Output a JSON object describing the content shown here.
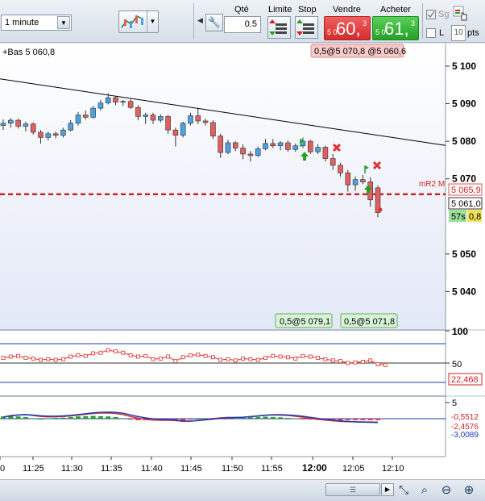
{
  "toolbar": {
    "timeframe": "1 minute",
    "qty_label": "Qté",
    "qty_value": "0.5",
    "limit_label": "Limite",
    "stop_label": "Stop",
    "sell_label": "Vendre",
    "buy_label": "Acheter",
    "sell_prefix": "5 0",
    "sell_big": "60,",
    "sell_sup": "3",
    "buy_prefix": "5 0",
    "buy_big": "61,",
    "buy_sup": "3",
    "sg_label": "Sg",
    "l_label": "L",
    "pts_value": "10",
    "pts_label": "pts"
  },
  "chart": {
    "low_label": "+Bas 5 060,8",
    "order_top": "0,5@5 070,8 @5 060,6",
    "order_bottom_1": "0,5@5 079,1",
    "order_bottom_2": "0,5@5 071,8",
    "mr2_label": "mR2 M",
    "mr2_value": "5 065,9",
    "current_price": "5 061,0",
    "countdown": "57s",
    "spread": "0,8",
    "rsi_value": "22,468",
    "macd_val_1": "-0,5512",
    "macd_val_2": "-2,4576",
    "macd_val_3": "-3,0089",
    "price_ticks": [
      "5 100",
      "5 090",
      "5 080",
      "5 070",
      "5 050",
      "5 040"
    ],
    "rsi_ticks": [
      "100",
      "50"
    ],
    "macd_ticks": [
      "5"
    ],
    "time_ticks": [
      "0",
      "11:25",
      "11:30",
      "11:35",
      "11:40",
      "11:45",
      "11:50",
      "11:55",
      "12:00",
      "12:05",
      "12:10"
    ]
  },
  "chart_data": {
    "type": "candlestick",
    "ylim": [
      5030,
      5106
    ],
    "candles": [
      [
        5084.2,
        5085.8,
        5083.0,
        5084.8
      ],
      [
        5084.8,
        5086.2,
        5083.6,
        5085.6
      ],
      [
        5085.6,
        5086.0,
        5083.4,
        5084.0
      ],
      [
        5084.0,
        5085.2,
        5082.6,
        5084.6
      ],
      [
        5084.6,
        5085.0,
        5081.8,
        5082.4
      ],
      [
        5082.4,
        5083.0,
        5079.4,
        5081.0
      ],
      [
        5081.0,
        5082.6,
        5080.2,
        5082.0
      ],
      [
        5082.0,
        5082.6,
        5080.8,
        5081.6
      ],
      [
        5081.6,
        5083.6,
        5081.0,
        5083.0
      ],
      [
        5083.0,
        5085.6,
        5082.6,
        5084.8
      ],
      [
        5084.8,
        5087.8,
        5084.2,
        5087.0
      ],
      [
        5087.0,
        5088.2,
        5085.8,
        5086.4
      ],
      [
        5086.4,
        5089.4,
        5086.0,
        5088.8
      ],
      [
        5088.8,
        5091.0,
        5088.2,
        5090.2
      ],
      [
        5090.2,
        5092.8,
        5089.8,
        5091.6
      ],
      [
        5091.6,
        5092.0,
        5089.6,
        5090.4
      ],
      [
        5090.4,
        5091.0,
        5089.4,
        5090.6
      ],
      [
        5090.6,
        5091.2,
        5088.6,
        5089.0
      ],
      [
        5089.0,
        5089.6,
        5085.6,
        5086.6
      ],
      [
        5086.6,
        5087.6,
        5084.6,
        5087.0
      ],
      [
        5087.0,
        5087.6,
        5084.6,
        5085.6
      ],
      [
        5085.6,
        5087.2,
        5085.0,
        5086.6
      ],
      [
        5086.6,
        5087.0,
        5082.0,
        5083.0
      ],
      [
        5083.0,
        5083.6,
        5078.6,
        5081.6
      ],
      [
        5081.6,
        5085.2,
        5081.0,
        5084.8
      ],
      [
        5084.8,
        5087.6,
        5084.2,
        5086.8
      ],
      [
        5086.8,
        5088.6,
        5084.6,
        5085.4
      ],
      [
        5085.4,
        5086.0,
        5084.2,
        5085.0
      ],
      [
        5085.0,
        5085.6,
        5080.6,
        5081.4
      ],
      [
        5081.4,
        5082.0,
        5075.6,
        5077.0
      ],
      [
        5077.0,
        5080.4,
        5076.6,
        5079.6
      ],
      [
        5079.6,
        5080.0,
        5077.4,
        5078.2
      ],
      [
        5078.2,
        5079.2,
        5075.2,
        5076.6
      ],
      [
        5076.6,
        5077.4,
        5074.6,
        5076.2
      ],
      [
        5076.2,
        5078.6,
        5075.8,
        5078.0
      ],
      [
        5078.0,
        5080.6,
        5077.6,
        5079.4
      ],
      [
        5079.4,
        5080.6,
        5078.2,
        5078.8
      ],
      [
        5078.8,
        5080.0,
        5077.6,
        5079.6
      ],
      [
        5079.6,
        5080.2,
        5077.2,
        5077.8
      ],
      [
        5077.8,
        5079.4,
        5077.2,
        5078.8
      ],
      [
        5078.8,
        5081.0,
        5078.2,
        5080.0
      ],
      [
        5080.0,
        5080.4,
        5076.6,
        5077.2
      ],
      [
        5077.2,
        5079.2,
        5076.6,
        5078.4
      ],
      [
        5078.4,
        5078.8,
        5074.6,
        5075.4
      ],
      [
        5075.4,
        5076.6,
        5072.4,
        5073.6
      ],
      [
        5073.6,
        5074.2,
        5070.6,
        5071.6
      ],
      [
        5071.6,
        5072.4,
        5066.6,
        5068.4
      ],
      [
        5068.4,
        5070.6,
        5066.8,
        5069.8
      ],
      [
        5069.8,
        5071.0,
        5068.6,
        5069.2
      ],
      [
        5069.2,
        5070.4,
        5062.6,
        5064.4
      ],
      [
        5067.6,
        5068.2,
        5059.8,
        5061.0
      ]
    ],
    "rsi_points": [
      58,
      60,
      61,
      58,
      57,
      55,
      56,
      55,
      56,
      60,
      62,
      61,
      65,
      66,
      70,
      68,
      66,
      62,
      60,
      61,
      56,
      57,
      60,
      53,
      59,
      62,
      63,
      61,
      59,
      55,
      56,
      54,
      57,
      56,
      55,
      58,
      61,
      60,
      59,
      57,
      61,
      60,
      58,
      56,
      54,
      53,
      50,
      51,
      52,
      54,
      48,
      47
    ],
    "macd_hist": [
      0.8,
      0.9,
      0.8,
      0.6,
      0.2,
      0.0,
      0.1,
      0.3,
      0.4,
      0.6,
      0.8,
      0.9,
      1.0,
      0.9,
      0.8,
      0.6,
      0.2,
      -0.3,
      -0.5,
      -0.5,
      -0.4,
      -0.3,
      -0.2,
      -0.4,
      -0.6,
      -0.3,
      0.0,
      0.2,
      0.3,
      0.4,
      0.3,
      0.2,
      0.3,
      0.5,
      0.6,
      0.7,
      0.6,
      0.5,
      0.3,
      0.1,
      -0.1,
      -0.3,
      -0.4,
      -0.5,
      -0.5,
      -0.6,
      -0.5,
      -0.5,
      -0.5,
      -0.5,
      -0.5
    ]
  },
  "colors": {
    "chart_bg": "#eef1fb",
    "up": "#4aa3e0",
    "down": "#e06060",
    "trend": "#000000",
    "mr2": "#d42020",
    "sell": "#d42c2c",
    "buy": "#25a025"
  },
  "bottom": {
    "icons": [
      "chart-fit-icon",
      "zoom-fit-icon",
      "zoom-out-icon",
      "zoom-in-icon"
    ]
  }
}
